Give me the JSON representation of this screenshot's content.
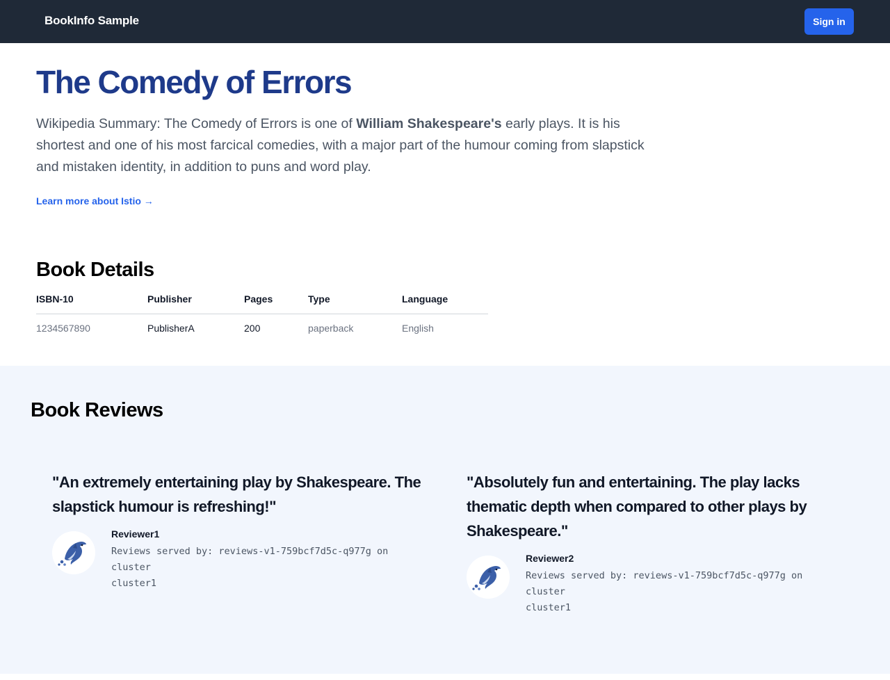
{
  "navbar": {
    "brand": "BookInfo Sample",
    "signin_label": "Sign in"
  },
  "book": {
    "title": "The Comedy of Errors",
    "summary_prefix": "Wikipedia Summary: The Comedy of Errors is one of ",
    "summary_bold": "William Shakespeare's",
    "summary_suffix": " early plays. It is his shortest and one of his most farcical comedies, with a major part of the humour coming from slapstick and mistaken identity, in addition to puns and word play.",
    "learn_more": "Learn more about Istio →"
  },
  "details": {
    "title": "Book Details",
    "headers": [
      "ISBN-10",
      "Publisher",
      "Pages",
      "Type",
      "Language"
    ],
    "row": [
      "1234567890",
      "PublisherA",
      "200",
      "paperback",
      "English"
    ]
  },
  "reviews": {
    "title": "Book Reviews",
    "items": [
      {
        "quote": "\"An extremely entertaining play by Shakespeare. The slapstick humour is refreshing!\"",
        "reviewer": "Reviewer1",
        "served_by": "Reviews served by: reviews-v1-759bcf7d5c-q977g on cluster",
        "cluster": "cluster1",
        "avatar_icon": "dolphin-icon"
      },
      {
        "quote": "\"Absolutely fun and entertaining. The play lacks thematic depth when compared to other plays by Shakespeare.\"",
        "reviewer": "Reviewer2",
        "served_by": "Reviews served by: reviews-v1-759bcf7d5c-q977g on cluster",
        "cluster": "cluster1",
        "avatar_icon": "dolphin-icon"
      }
    ]
  },
  "colors": {
    "navbar": "#1f2937",
    "accent": "#2563eb",
    "title": "#1e3a8a",
    "reviews_bg": "#f2f6fd"
  }
}
